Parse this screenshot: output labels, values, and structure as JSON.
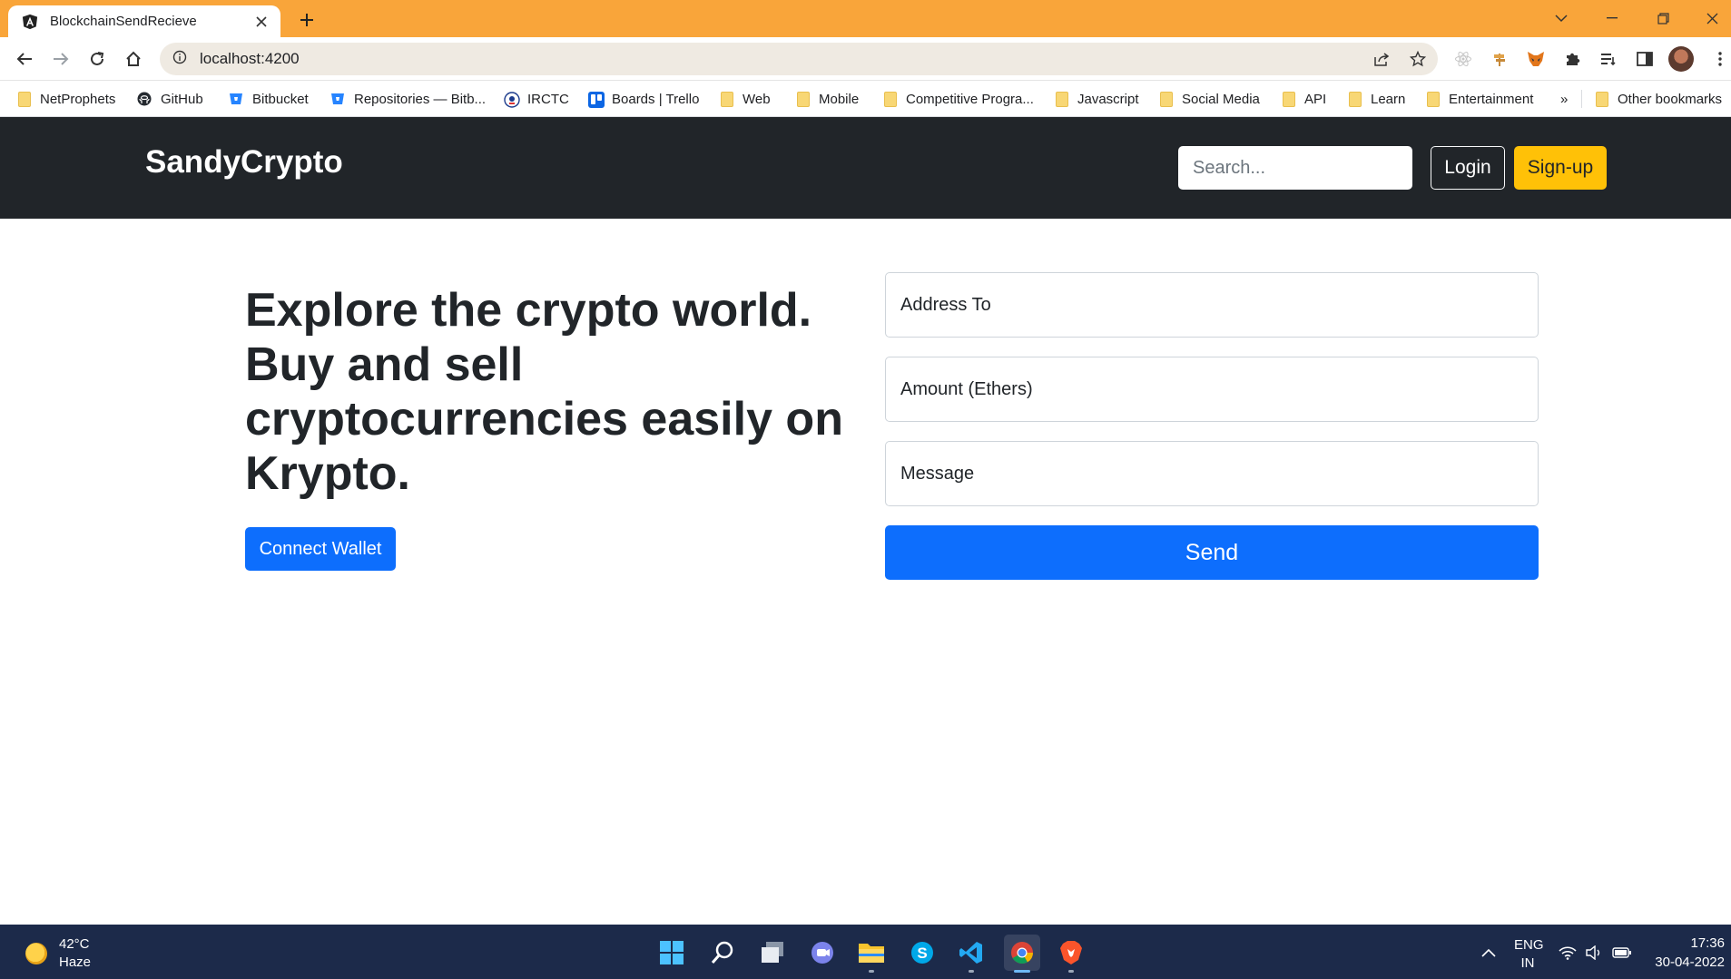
{
  "browser": {
    "tab_title": "BlockchainSendRecieve",
    "url": "localhost:4200",
    "bookmarks": [
      {
        "label": "NetProphets",
        "icon": "folder-icon"
      },
      {
        "label": "GitHub",
        "icon": "github-icon"
      },
      {
        "label": "Bitbucket",
        "icon": "bitbucket-icon"
      },
      {
        "label": "Repositories — Bitb...",
        "icon": "bitbucket-icon"
      },
      {
        "label": "IRCTC",
        "icon": "irctc-icon"
      },
      {
        "label": "Boards | Trello",
        "icon": "trello-icon"
      },
      {
        "label": "Web",
        "icon": "folder-icon"
      },
      {
        "label": "Mobile",
        "icon": "folder-icon"
      },
      {
        "label": "Competitive Progra...",
        "icon": "folder-icon"
      },
      {
        "label": "Javascript",
        "icon": "folder-icon"
      },
      {
        "label": "Social Media",
        "icon": "folder-icon"
      },
      {
        "label": "API",
        "icon": "folder-icon"
      },
      {
        "label": "Learn",
        "icon": "folder-icon"
      },
      {
        "label": "Entertainment",
        "icon": "folder-icon"
      }
    ],
    "overflow_label": "»",
    "other_bookmarks": "Other bookmarks"
  },
  "app": {
    "brand": "SandyCrypto",
    "search_placeholder": "Search...",
    "login_label": "Login",
    "signup_label": "Sign-up",
    "hero_text": "Explore the crypto world. Buy and sell cryptocurrencies easily on Krypto.",
    "connect_label": "Connect Wallet",
    "form": {
      "address_placeholder": "Address To",
      "amount_placeholder": "Amount (Ethers)",
      "message_placeholder": "Message",
      "send_label": "Send"
    }
  },
  "taskbar": {
    "temperature": "42°C",
    "weather": "Haze",
    "language": "ENG",
    "region": "IN",
    "time": "17:36",
    "date": "30-04-2022"
  },
  "colors": {
    "tabbar": "#f9a53a",
    "navbar": "#212529",
    "primary": "#0d6efd",
    "warning": "#ffc107",
    "taskbar": "#1c2a4a"
  }
}
